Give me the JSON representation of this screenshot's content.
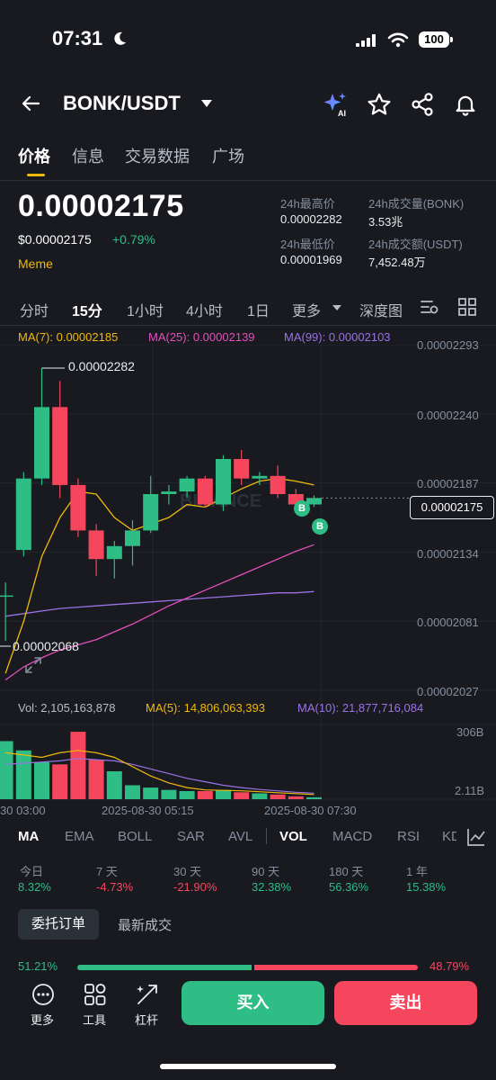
{
  "status": {
    "time": "07:31",
    "battery": "100"
  },
  "header": {
    "pair": "BONK/USDT"
  },
  "tabs": [
    "价格",
    "信息",
    "交易数据",
    "广场"
  ],
  "price": {
    "last": "0.00002175",
    "usd": "$0.00002175",
    "change": "+0.79%",
    "tag": "Meme"
  },
  "stats": {
    "high_label": "24h最高价",
    "high": "0.00002282",
    "low_label": "24h最低价",
    "low": "0.00001969",
    "vol_base_label": "24h成交量(BONK)",
    "vol_base": "3.53兆",
    "vol_quote_label": "24h成交额(USDT)",
    "vol_quote": "7,452.48万"
  },
  "intervals": [
    "分时",
    "15分",
    "1小时",
    "4小时",
    "1日",
    "更多",
    "深度图"
  ],
  "ma_legend": {
    "ma7": "MA(7): 0.00002185",
    "ma25": "MA(25): 0.00002139",
    "ma99": "MA(99): 0.00002103"
  },
  "chart_data": {
    "type": "candlestick",
    "y_ticks": [
      "0.00002293",
      "0.00002240",
      "0.00002187",
      "0.00002134",
      "0.00002081",
      "0.00002027"
    ],
    "ylim": [
      2.027e-05,
      2.293e-05
    ],
    "current_price_label": "0.00002175",
    "high_marker": "0.00002282",
    "low_marker": "0.00002068",
    "x_ticks": [
      "30 03:00",
      "2025-08-30 05:15",
      "2025-08-30 07:30"
    ],
    "watermark": "BINANCE",
    "candles": [
      {
        "o": 2.1e-05,
        "c": 2.1e-05,
        "h": 2.11e-05,
        "l": 2.065e-05,
        "dir": "up"
      },
      {
        "o": 2.135e-05,
        "c": 2.19e-05,
        "h": 2.195e-05,
        "l": 2.13e-05,
        "dir": "up"
      },
      {
        "o": 2.19e-05,
        "c": 2.245e-05,
        "h": 2.275e-05,
        "l": 2.185e-05,
        "dir": "up"
      },
      {
        "o": 2.245e-05,
        "c": 2.185e-05,
        "h": 2.265e-05,
        "l": 2.175e-05,
        "dir": "down"
      },
      {
        "o": 2.185e-05,
        "c": 2.15e-05,
        "h": 2.19e-05,
        "l": 2.145e-05,
        "dir": "down"
      },
      {
        "o": 2.15e-05,
        "c": 2.128e-05,
        "h": 2.155e-05,
        "l": 2.115e-05,
        "dir": "down"
      },
      {
        "o": 2.128e-05,
        "c": 2.138e-05,
        "h": 2.142e-05,
        "l": 2.113e-05,
        "dir": "up"
      },
      {
        "o": 2.138e-05,
        "c": 2.15e-05,
        "h": 2.158e-05,
        "l": 2.123e-05,
        "dir": "up"
      },
      {
        "o": 2.15e-05,
        "c": 2.178e-05,
        "h": 2.192e-05,
        "l": 2.148e-05,
        "dir": "up"
      },
      {
        "o": 2.178e-05,
        "c": 2.18e-05,
        "h": 2.185e-05,
        "l": 2.17e-05,
        "dir": "up"
      },
      {
        "o": 2.18e-05,
        "c": 2.19e-05,
        "h": 2.192e-05,
        "l": 2.175e-05,
        "dir": "up"
      },
      {
        "o": 2.19e-05,
        "c": 2.17e-05,
        "h": 2.192e-05,
        "l": 2.168e-05,
        "dir": "down"
      },
      {
        "o": 2.17e-05,
        "c": 2.205e-05,
        "h": 2.208e-05,
        "l": 2.165e-05,
        "dir": "up"
      },
      {
        "o": 2.205e-05,
        "c": 2.19e-05,
        "h": 2.212e-05,
        "l": 2.185e-05,
        "dir": "down"
      },
      {
        "o": 2.19e-05,
        "c": 2.192e-05,
        "h": 2.195e-05,
        "l": 2.185e-05,
        "dir": "up"
      },
      {
        "o": 2.192e-05,
        "c": 2.178e-05,
        "h": 2.2e-05,
        "l": 2.175e-05,
        "dir": "down"
      },
      {
        "o": 2.178e-05,
        "c": 2.17e-05,
        "h": 2.182e-05,
        "l": 2.165e-05,
        "dir": "down"
      },
      {
        "o": 2.17e-05,
        "c": 2.175e-05,
        "h": 2.177e-05,
        "l": 2.168e-05,
        "dir": "up"
      }
    ],
    "ma7": [
      2.04e-05,
      2.08e-05,
      2.13e-05,
      2.16e-05,
      2.18e-05,
      2.178e-05,
      2.16e-05,
      2.15e-05,
      2.155e-05,
      2.16e-05,
      2.17e-05,
      2.168e-05,
      2.175e-05,
      2.182e-05,
      2.188e-05,
      2.19e-05,
      2.188e-05,
      2.185e-05
    ],
    "ma25": [
      2.035e-05,
      2.045e-05,
      2.052e-05,
      2.058e-05,
      2.062e-05,
      2.066e-05,
      2.072e-05,
      2.078e-05,
      2.085e-05,
      2.092e-05,
      2.098e-05,
      2.104e-05,
      2.11e-05,
      2.116e-05,
      2.122e-05,
      2.128e-05,
      2.134e-05,
      2.139e-05
    ],
    "ma99": [
      2.084e-05,
      2.086e-05,
      2.088e-05,
      2.09e-05,
      2.091e-05,
      2.092e-05,
      2.093e-05,
      2.094e-05,
      2.095e-05,
      2.096e-05,
      2.097e-05,
      2.098e-05,
      2.099e-05,
      2.1e-05,
      2.101e-05,
      2.102e-05,
      2.102e-05,
      2.103e-05
    ],
    "volume": {
      "legend": {
        "vol": "Vol: 2,105,163,878",
        "ma5": "MA(5): 14,806,063,393",
        "ma10": "MA(10): 21,877,716,084"
      },
      "y_ticks": [
        "306B",
        "2.11B"
      ],
      "ylim": [
        0,
        306
      ],
      "values": [
        250,
        210,
        160,
        150,
        290,
        170,
        120,
        60,
        50,
        40,
        35,
        35,
        40,
        30,
        25,
        20,
        12,
        8
      ],
      "ma5": [
        200,
        190,
        180,
        200,
        210,
        200,
        180,
        140,
        100,
        70,
        50,
        40,
        38,
        36,
        32,
        28,
        24,
        20
      ],
      "ma10": [
        150,
        155,
        160,
        165,
        175,
        170,
        165,
        150,
        130,
        110,
        90,
        75,
        60,
        50,
        42,
        36,
        30,
        26
      ]
    }
  },
  "indicators": [
    "MA",
    "EMA",
    "BOLL",
    "SAR",
    "AVL",
    "VOL",
    "MACD",
    "RSI",
    "KD"
  ],
  "performance": [
    {
      "label": "今日",
      "value": "8.32%",
      "dir": "up"
    },
    {
      "label": "7 天",
      "value": "-4.73%",
      "dir": "down"
    },
    {
      "label": "30 天",
      "value": "-21.90%",
      "dir": "down"
    },
    {
      "label": "90 天",
      "value": "32.38%",
      "dir": "up"
    },
    {
      "label": "180 天",
      "value": "56.36%",
      "dir": "up"
    },
    {
      "label": "1 年",
      "value": "15.38%",
      "dir": "up"
    }
  ],
  "orders": {
    "tab_active": "委托订单",
    "tab_2": "最新成交",
    "buy_pct": "51.21%",
    "sell_pct": "48.79%"
  },
  "bottom": {
    "more": "更多",
    "tools": "工具",
    "leverage": "杠杆",
    "buy": "买入",
    "sell": "卖出"
  },
  "colors": {
    "up": "#2ebd85",
    "down": "#f6465d",
    "ma7": "#f0b90b",
    "ma25": "#e44fbd",
    "ma99": "#9b72e6",
    "accent": "#f0b90b"
  }
}
